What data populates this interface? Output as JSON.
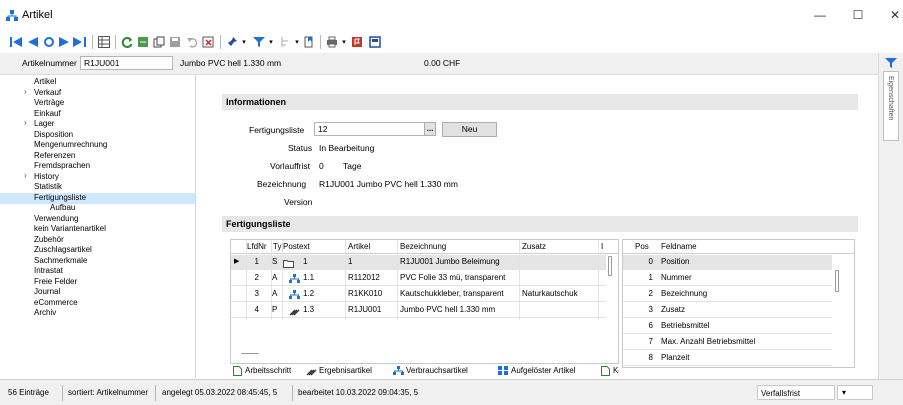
{
  "window": {
    "title": "Artikel",
    "minimize_glyph": "—",
    "maximize_glyph": "☐",
    "close_glyph": "✕"
  },
  "toolbar": {
    "icons": [
      "first-record-icon",
      "prev-record-icon",
      "refresh-nav-icon",
      "next-record-icon",
      "last-record-icon",
      "grid-view-icon",
      "reload-icon",
      "export-icon",
      "copy-icon",
      "save-icon",
      "undo-icon",
      "delete-icon",
      "pin-icon",
      "filter-icon",
      "sort-icon",
      "bookmark-icon",
      "print-icon",
      "flag-icon",
      "extra-icon"
    ]
  },
  "header": {
    "artikelnummer_label": "Artikelnummer",
    "artikelnummer_value": "R1JU001",
    "description": "Jumbo PVC hell 1.330 mm",
    "price": "0.00 CHF"
  },
  "tree": {
    "items": [
      {
        "label": "Artikel",
        "expandable": false,
        "indent": 0
      },
      {
        "label": "Verkauf",
        "expandable": true,
        "indent": 0
      },
      {
        "label": "Verträge",
        "expandable": false,
        "indent": 0
      },
      {
        "label": "Einkauf",
        "expandable": false,
        "indent": 0
      },
      {
        "label": "Lager",
        "expandable": true,
        "indent": 0
      },
      {
        "label": "Disposition",
        "expandable": false,
        "indent": 0
      },
      {
        "label": "Mengenumrechnung",
        "expandable": false,
        "indent": 0
      },
      {
        "label": "Referenzen",
        "expandable": false,
        "indent": 0
      },
      {
        "label": "Fremdsprachen",
        "expandable": false,
        "indent": 0
      },
      {
        "label": "History",
        "expandable": true,
        "indent": 0
      },
      {
        "label": "Statistik",
        "expandable": false,
        "indent": 0
      },
      {
        "label": "Fertigungsliste",
        "expandable": true,
        "expanded": true,
        "indent": 0,
        "selected": true
      },
      {
        "label": "Aufbau",
        "expandable": false,
        "indent": 1
      },
      {
        "label": "Verwendung",
        "expandable": false,
        "indent": 0
      },
      {
        "label": "kein Variantenartikel",
        "expandable": false,
        "indent": 0
      },
      {
        "label": "Zubehör",
        "expandable": false,
        "indent": 0
      },
      {
        "label": "Zuschlagsartikel",
        "expandable": false,
        "indent": 0
      },
      {
        "label": "Sachmerkmale",
        "expandable": false,
        "indent": 0
      },
      {
        "label": "Intrastat",
        "expandable": false,
        "indent": 0
      },
      {
        "label": "Freie Felder",
        "expandable": false,
        "indent": 0
      },
      {
        "label": "Journal",
        "expandable": false,
        "indent": 0
      },
      {
        "label": "eCommerce",
        "expandable": false,
        "indent": 0
      },
      {
        "label": "Archiv",
        "expandable": false,
        "indent": 0
      }
    ]
  },
  "informationen": {
    "section_title": "Informationen",
    "fertigungsliste_label": "Fertigungsliste",
    "fertigungsliste_value": "12",
    "browse_button": "...",
    "neu_button": "Neu",
    "status_label": "Status",
    "status_value": "In Bearbeitung",
    "vorlauffrist_label": "Vorlauffrist",
    "vorlauffrist_value": "0",
    "vorlauffrist_unit": "Tage",
    "bezeichnung_label": "Bezeichnung",
    "bezeichnung_value": "R1JU001 Jumbo PVC hell 1.330 mm",
    "version_label": "Version",
    "version_value": ""
  },
  "fertigungsliste": {
    "section_title": "Fertigungsliste",
    "columns": [
      "LfdNr",
      "Ty",
      "Postext",
      "Artikel",
      "Bezeichnung",
      "Zusatz",
      "I"
    ],
    "rows": [
      {
        "lfdnr": "1",
        "typ": "S",
        "postext": "1",
        "artikel": "1",
        "bezeichnung": "R1JU001 Jumbo Beleimung",
        "zusatz": "",
        "icon": "folder-icon",
        "current": true
      },
      {
        "lfdnr": "2",
        "typ": "A",
        "postext": "1.1",
        "artikel": "R112012",
        "bezeichnung": "PVC Folie 33 mü, transparent",
        "zusatz": "",
        "icon": "component-icon"
      },
      {
        "lfdnr": "3",
        "typ": "A",
        "postext": "1.2",
        "artikel": "R1KK010",
        "bezeichnung": "Kautschukkleber, transparent",
        "zusatz": "Naturkautschuk",
        "icon": "component-icon"
      },
      {
        "lfdnr": "4",
        "typ": "P",
        "postext": "1.3",
        "artikel": "R1JU001",
        "bezeichnung": "Jumbo PVC hell 1.330 mm",
        "zusatz": "",
        "icon": "product-icon"
      }
    ],
    "legend": [
      {
        "label": "Arbeitsschritt",
        "icon": "document-icon"
      },
      {
        "label": "Ergebnisartikel",
        "icon": "product-icon"
      },
      {
        "label": "Verbrauchsartikel",
        "icon": "component-icon"
      },
      {
        "label": "Aufgelöster Artikel",
        "icon": "resolved-icon"
      },
      {
        "label": "Ko",
        "icon": "document-icon"
      }
    ]
  },
  "feldliste": {
    "columns": [
      "Pos",
      "Feldname"
    ],
    "rows": [
      {
        "pos": "0",
        "name": "Position"
      },
      {
        "pos": "1",
        "name": "Nummer"
      },
      {
        "pos": "2",
        "name": "Bezeichnung"
      },
      {
        "pos": "3",
        "name": "Zusatz"
      },
      {
        "pos": "6",
        "name": "Betriebsmittel"
      },
      {
        "pos": "7",
        "name": "Max. Anzahl Betriebsmittel"
      },
      {
        "pos": "8",
        "name": "Planzeit"
      }
    ]
  },
  "right_panel": {
    "label": "Eigenschaften"
  },
  "status_bar": {
    "count": "56 Einträge",
    "sort": "sortiert: Artikelnummer",
    "created": "angelegt 05.03.2022 08:45:45, 5",
    "edited": "bearbeitet 10.03.2022 09:04:35, 5",
    "filter_value": "Verfallsfrist"
  },
  "colors": {
    "row_selected": "#e5e5e5",
    "tree_selected": "#cde8ff",
    "accent_blue": "#1e6fd9"
  }
}
